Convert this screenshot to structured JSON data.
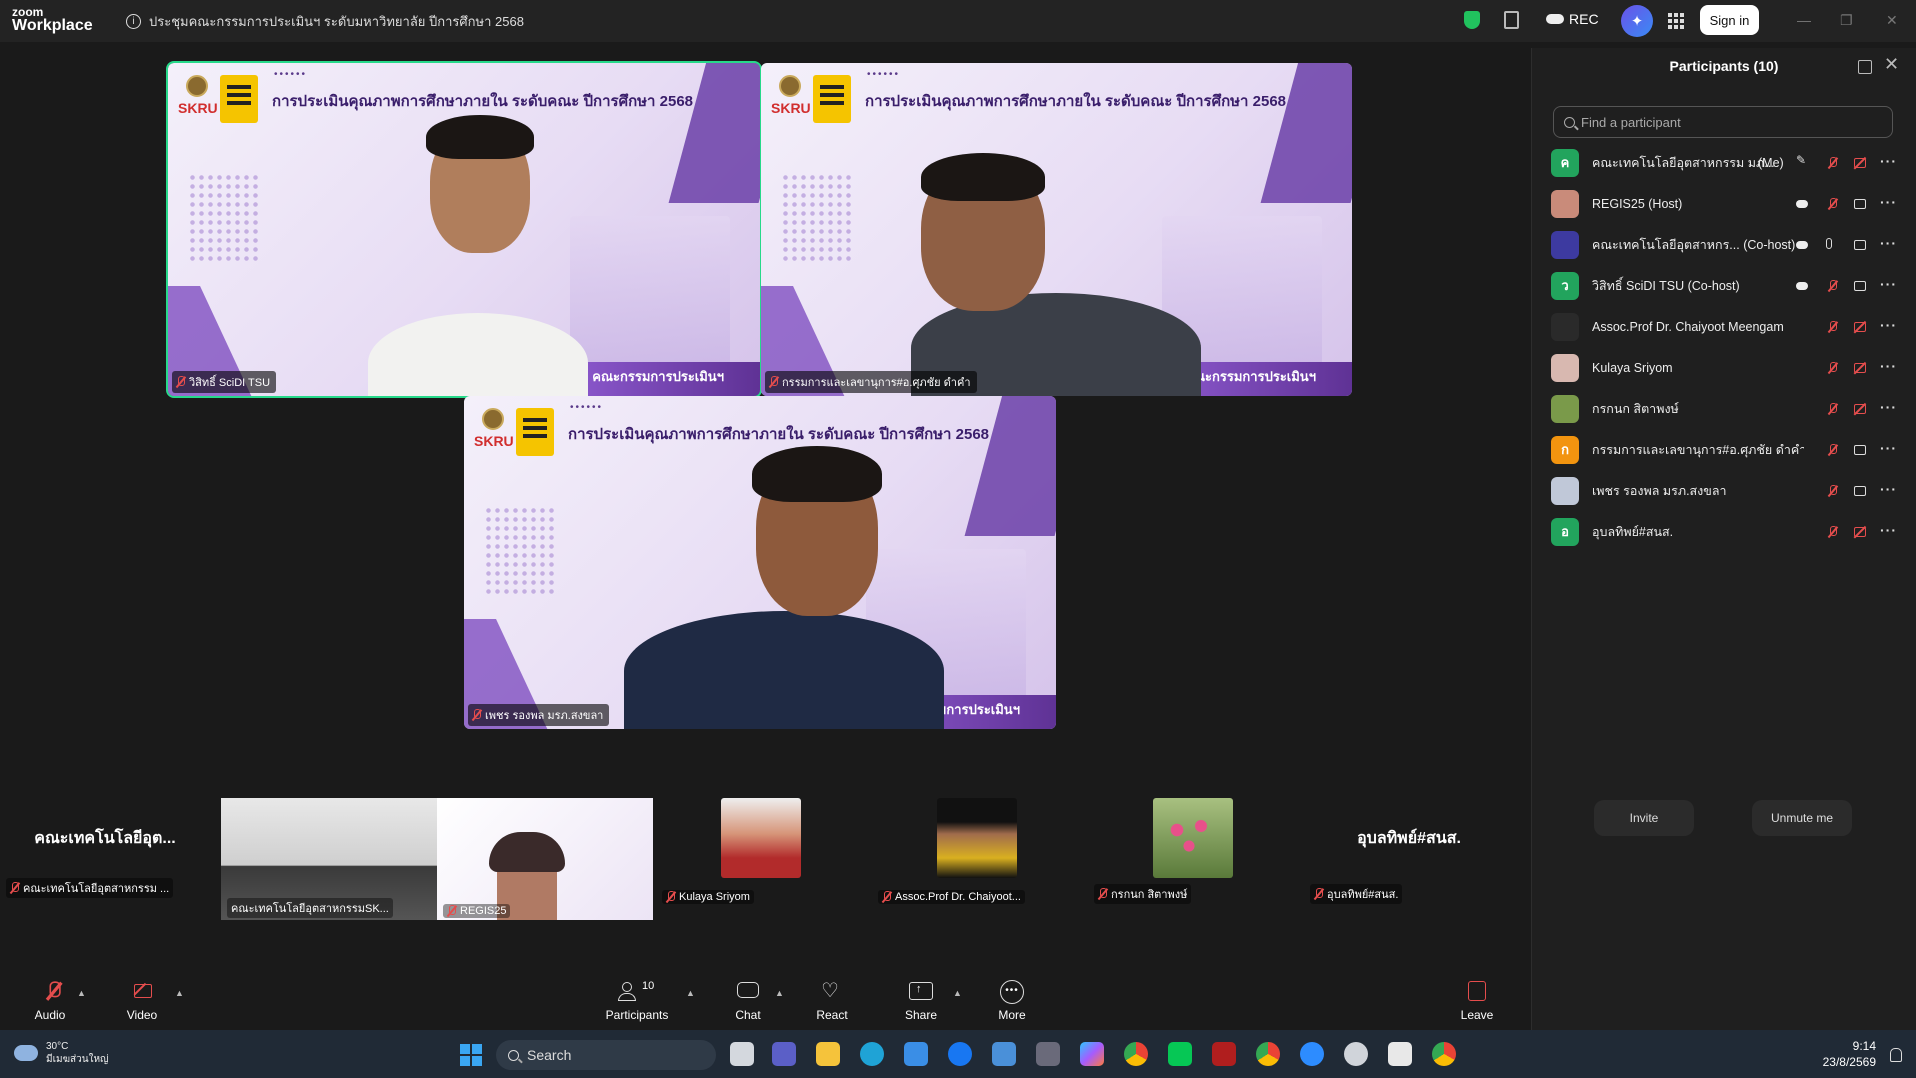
{
  "brand": {
    "line1": "zoom",
    "line2": "Workplace"
  },
  "meeting": {
    "title": "ประชุมคณะกรรมการประเมินฯ ระดับมหาวิทยาลัย ปีการศึกษา 2568",
    "info_glyph": "i"
  },
  "titlebar": {
    "rec_label": "REC",
    "signin_label": "Sign in",
    "minimize": "—",
    "restore": "❐",
    "close": "✕",
    "ai_glyph": "✦"
  },
  "slide": {
    "title": "การประเมินคุณภาพการศึกษาภายใน ระดับคณะ ปีการศึกษา 2568",
    "logo_text": "SKRU",
    "footer": "คณะกรรมการประเมินฯ",
    "dots": "••••••"
  },
  "tiles": [
    {
      "name": "วิสิทธิ์ SciDI TSU",
      "active": true
    },
    {
      "name": "กรรมการและเลขานุการ#อ.ศุภชัย ดำคำ",
      "active": false
    },
    {
      "name": "เพชร รองพล มรภ.สงขลา",
      "active": false
    }
  ],
  "strip": [
    {
      "big": "คณะเทคโนโลยีอุต...",
      "name": "คณะเทคโนโลยีอุตสาหกรรม ..."
    },
    {
      "big": "",
      "name": "คณะเทคโนโลยีอุตสาหกรรมSK..."
    },
    {
      "big": "",
      "name": "REGIS25"
    },
    {
      "big": "",
      "name": "Kulaya Sriyom"
    },
    {
      "big": "",
      "name": "Assoc.Prof Dr. Chaiyoot..."
    },
    {
      "big": "",
      "name": "กรกนก สิตาพงษ์"
    },
    {
      "big": "อุบลทิพย์#สนส.",
      "name": "อุบลทิพย์#สนส."
    }
  ],
  "toolbar": {
    "audio": "Audio",
    "video": "Video",
    "participants": "Participants",
    "participants_count": "10",
    "chat": "Chat",
    "react": "React",
    "share": "Share",
    "more": "More",
    "leave": "Leave"
  },
  "panel": {
    "title": "Participants (10)",
    "search_placeholder": "Find a participant",
    "close_glyph": "✕",
    "invite": "Invite",
    "unmute": "Unmute me",
    "participants": [
      {
        "initial": "ค",
        "color": "#22a45d",
        "name": "คณะเทคโนโลยีอุตสาหกรรม มภ...",
        "tag": "(Me)",
        "video": "off",
        "cloud": false,
        "mic": "off"
      },
      {
        "initial": "",
        "color": "#c98b7a",
        "name": "REGIS25 (Host)",
        "tag": "",
        "video": "on",
        "cloud": true,
        "mic": "off"
      },
      {
        "initial": "",
        "color": "#3d3aa0",
        "name": "คณะเทคโนโลยีอุตสาหกร...   (Co-host)",
        "tag": "",
        "video": "on",
        "cloud": true,
        "mic": "on"
      },
      {
        "initial": "ว",
        "color": "#22a45d",
        "name": "วิสิทธิ์ SciDI TSU (Co-host)",
        "tag": "",
        "video": "on",
        "cloud": true,
        "mic": "off"
      },
      {
        "initial": "",
        "color": "#2a2a2a",
        "name": "Assoc.Prof Dr. Chaiyoot Meengam",
        "tag": "",
        "video": "off",
        "cloud": false,
        "mic": "off"
      },
      {
        "initial": "",
        "color": "#d8b8b0",
        "name": "Kulaya Sriyom",
        "tag": "",
        "video": "off",
        "cloud": false,
        "mic": "off"
      },
      {
        "initial": "",
        "color": "#7a9a4a",
        "name": "กรกนก สิตาพงษ์",
        "tag": "",
        "video": "off",
        "cloud": false,
        "mic": "off"
      },
      {
        "initial": "ก",
        "color": "#f2940f",
        "name": "กรรมการและเลขานุการ#อ.ศุภชัย ดำคำ",
        "tag": "",
        "video": "on",
        "cloud": false,
        "mic": "off"
      },
      {
        "initial": "",
        "color": "#c0c8d8",
        "name": "เพชร รองพล มรภ.สงขลา",
        "tag": "",
        "video": "on",
        "cloud": false,
        "mic": "off"
      },
      {
        "initial": "อ",
        "color": "#22a45d",
        "name": "อุบลทิพย์#สนส.",
        "tag": "",
        "video": "off",
        "cloud": false,
        "mic": "off"
      }
    ]
  },
  "taskbar": {
    "temp": "30°C",
    "weather_desc": "มีเมฆส่วนใหญ่",
    "search_label": "Search",
    "time": "9:14",
    "date": "23/8/2569"
  }
}
